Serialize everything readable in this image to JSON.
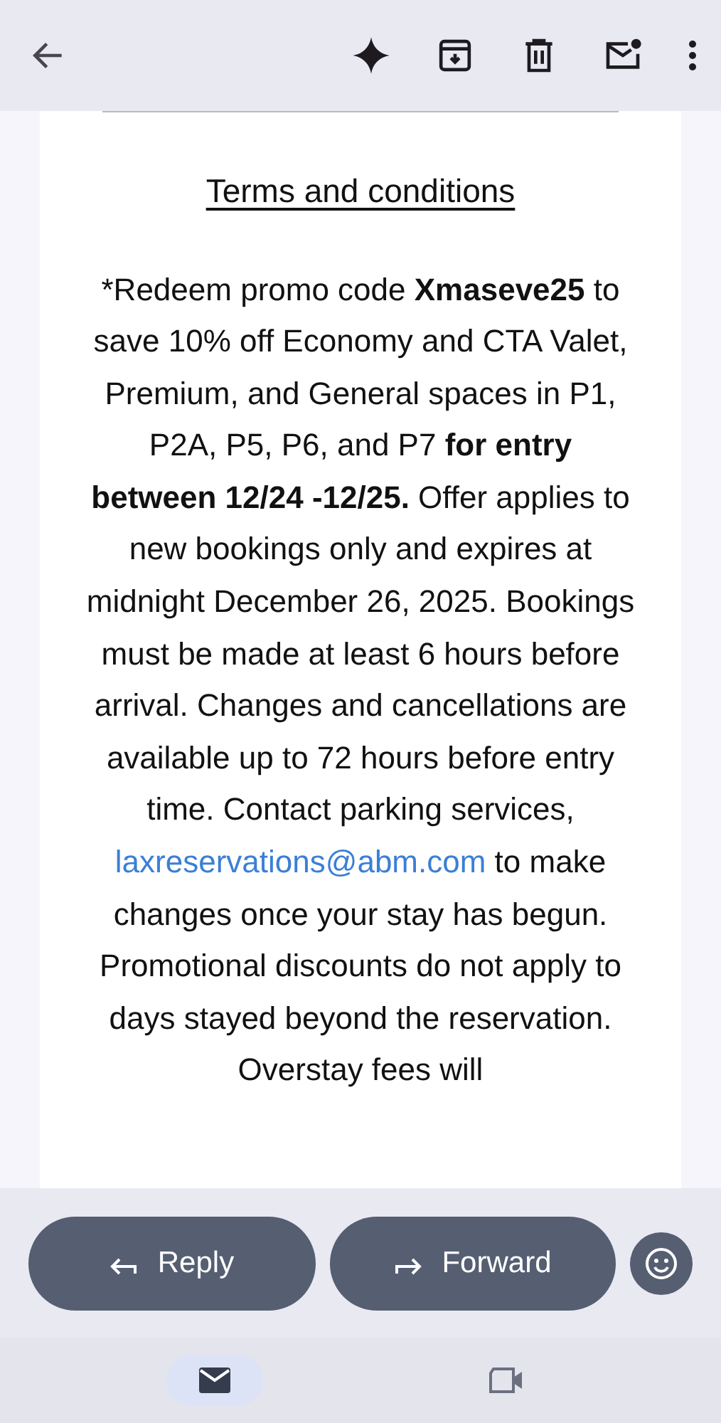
{
  "message": {
    "title": "Terms and conditions",
    "body_before": "*Redeem promo code **Xmaseve25** to save 10% off Economy and CTA Valet, Premium, and General spaces in P1, P2A, P5, P6, and P7 **for entry between 12/24 -12/25.** Offer applies to new bookings only and expires at midnight December 26, 2025. Bookings must be made at least 6 hours before arrival. Changes and cancellations are available up to 72 hours before entry time. Contact parking services,",
    "link": "laxreservations@abm.com",
    "body_after": "to make changes once your stay has begun. Promotional discounts do not apply to days stayed beyond the reservation. Overstay fees will"
  },
  "actions": [
    {
      "kind": "reply",
      "label": "Reply"
    },
    {
      "kind": "forward",
      "label": "Forward"
    }
  ],
  "nav": [
    {
      "kind": "mail",
      "selected": true
    },
    {
      "kind": "video",
      "selected": false
    }
  ]
}
